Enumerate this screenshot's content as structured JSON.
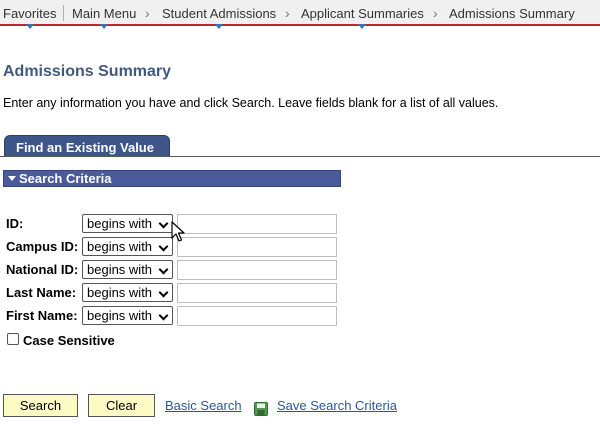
{
  "breadcrumb": {
    "favorites": "Favorites",
    "main_menu": "Main Menu",
    "student_admissions": "Student Admissions",
    "applicant_summaries": "Applicant Summaries",
    "current": "Admissions Summary",
    "separator": "›"
  },
  "page": {
    "title": "Admissions Summary",
    "instructions": "Enter any information you have and click Search. Leave fields blank for a list of all values."
  },
  "tabs": {
    "find_existing": "Find an Existing Value"
  },
  "search_criteria": {
    "header": "Search Criteria",
    "fields": [
      {
        "label": "ID:",
        "operator": "begins with",
        "value": ""
      },
      {
        "label": "Campus ID:",
        "operator": "begins with",
        "value": ""
      },
      {
        "label": "National ID:",
        "operator": "begins with",
        "value": ""
      },
      {
        "label": "Last Name:",
        "operator": "begins with",
        "value": ""
      },
      {
        "label": "First Name:",
        "operator": "begins with",
        "value": ""
      }
    ],
    "case_sensitive_label": "Case Sensitive",
    "case_sensitive_checked": false
  },
  "actions": {
    "search": "Search",
    "clear": "Clear",
    "basic_search": "Basic Search",
    "save_search_criteria": "Save Search Criteria"
  },
  "colors": {
    "accent_red": "#c0272d",
    "tab_blue": "#3d5588",
    "criteria_bar": "#4a5a9c",
    "link_blue": "#2b5699",
    "button_yellow": "#fdfbc4",
    "title_blue": "#415a7e"
  }
}
